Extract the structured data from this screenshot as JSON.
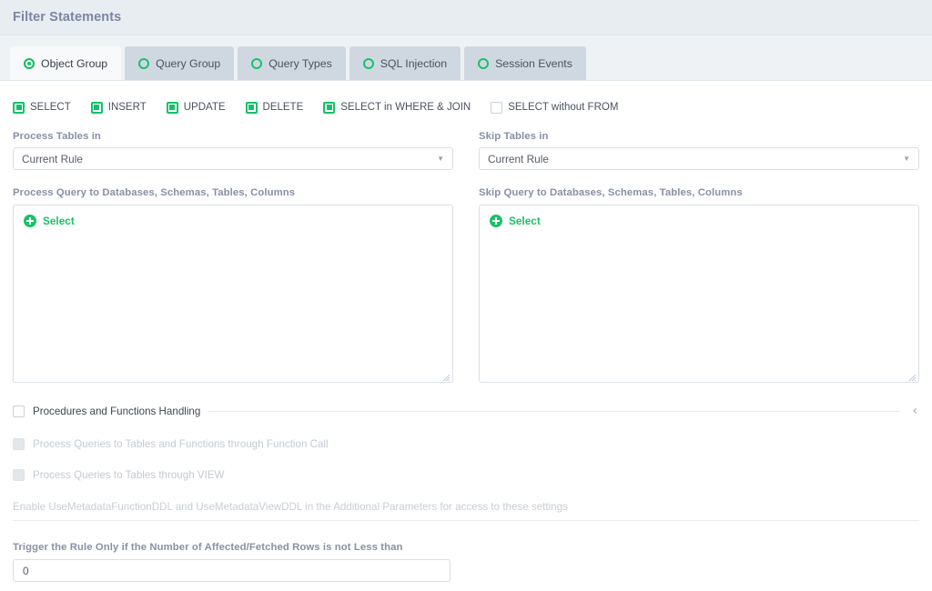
{
  "header": {
    "title": "Filter Statements"
  },
  "tabs": [
    {
      "label": "Object Group",
      "active": true,
      "icon": "radio-selected-icon"
    },
    {
      "label": "Query Group",
      "active": false,
      "icon": "radio-unselected-icon"
    },
    {
      "label": "Query Types",
      "active": false,
      "icon": "radio-unselected-icon"
    },
    {
      "label": "SQL Injection",
      "active": false,
      "icon": "radio-unselected-icon"
    },
    {
      "label": "Session Events",
      "active": false,
      "icon": "radio-unselected-icon"
    }
  ],
  "statement_checkboxes": [
    {
      "label": "SELECT",
      "state": "checked"
    },
    {
      "label": "INSERT",
      "state": "checked"
    },
    {
      "label": "UPDATE",
      "state": "checked"
    },
    {
      "label": "DELETE",
      "state": "checked"
    },
    {
      "label": "SELECT in WHERE & JOIN",
      "state": "checked"
    },
    {
      "label": "SELECT without FROM",
      "state": "unchecked"
    }
  ],
  "process": {
    "tables_in_label": "Process Tables in",
    "tables_in_value": "Current Rule",
    "query_label": "Process Query to Databases, Schemas, Tables, Columns",
    "select_label": "Select"
  },
  "skip": {
    "tables_in_label": "Skip Tables in",
    "tables_in_value": "Current Rule",
    "query_label": "Skip Query to Databases, Schemas, Tables, Columns",
    "select_label": "Select"
  },
  "procedures": {
    "section_label": "Procedures and Functions Handling",
    "section_state": "unchecked",
    "collapse_icon": "chevron-left-icon",
    "sub_options": [
      {
        "label": "Process Queries to Tables and Functions through Function Call",
        "state": "disabled"
      },
      {
        "label": "Process Queries to Tables through VIEW",
        "state": "disabled"
      }
    ],
    "note": "Enable UseMetadataFunctionDDL and UseMetadataViewDDL in the Additional Parameters for access to these settings"
  },
  "trigger": {
    "label": "Trigger the Rule Only if the Number of Affected/Fetched Rows is not Less than",
    "value": "0",
    "placeholder": "0"
  },
  "colors": {
    "accent_green": "#18c268",
    "header_bg": "#e8edf1",
    "tab_inactive_bg": "#cfd8e0",
    "label_gray": "#8790a6"
  }
}
